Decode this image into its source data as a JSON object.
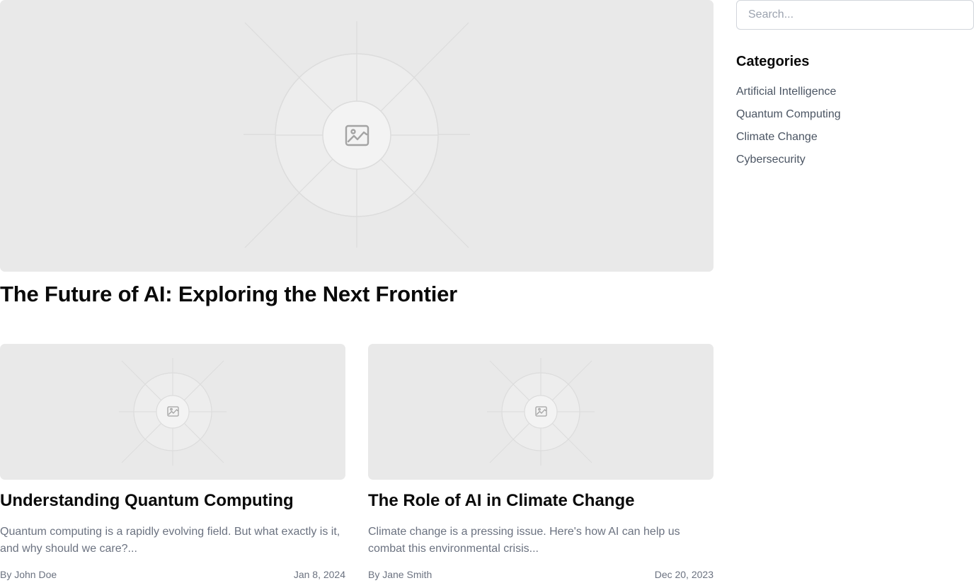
{
  "featured": {
    "title": "The Future of AI: Exploring the Next Frontier",
    "image_icon": "image-placeholder-icon"
  },
  "posts": [
    {
      "title": "Understanding Quantum Computing",
      "excerpt": "Quantum computing is a rapidly evolving field. But what exactly is it, and why should we care?...",
      "author": "By John Doe",
      "date": "Jan 8, 2024",
      "image_icon": "image-placeholder-icon"
    },
    {
      "title": "The Role of AI in Climate Change",
      "excerpt": "Climate change is a pressing issue. Here's how AI can help us combat this environmental crisis...",
      "author": "By Jane Smith",
      "date": "Dec 20, 2023",
      "image_icon": "image-placeholder-icon"
    }
  ],
  "sidebar": {
    "search": {
      "placeholder": "Search...",
      "value": ""
    },
    "categories_heading": "Categories",
    "categories": [
      {
        "label": "Artificial Intelligence"
      },
      {
        "label": "Quantum Computing"
      },
      {
        "label": "Climate Change"
      },
      {
        "label": "Cybersecurity"
      }
    ]
  },
  "colors": {
    "placeholder_bg": "#e9e9e9",
    "muted_text": "#6b7280",
    "link_text": "#4b5563",
    "heading_text": "#0a0a0a"
  }
}
